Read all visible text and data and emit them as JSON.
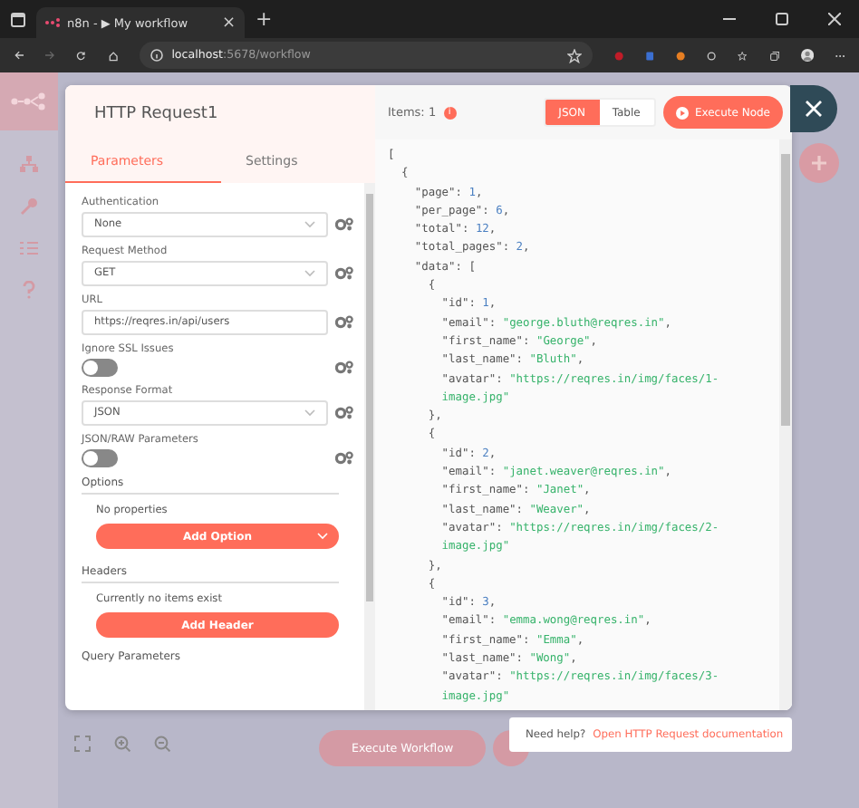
{
  "browser": {
    "tab_title": "n8n - ▶ My workflow",
    "tab_close": "×",
    "new_tab": "+",
    "address": {
      "host": "localhost",
      "rest": ":5678/workflow"
    }
  },
  "node": {
    "title": "HTTP Request1",
    "tabs": [
      {
        "label": "Parameters",
        "selected": true
      },
      {
        "label": "Settings",
        "selected": false
      }
    ],
    "parameters": [
      {
        "kind": "select",
        "label": "Authentication",
        "value": "None"
      },
      {
        "kind": "select",
        "label": "Request Method",
        "value": "GET"
      },
      {
        "kind": "input",
        "label": "URL",
        "value": "https://reqres.in/api/users"
      },
      {
        "kind": "toggle",
        "label": "Ignore SSL Issues",
        "on": false
      },
      {
        "kind": "select",
        "label": "Response Format",
        "value": "JSON"
      },
      {
        "kind": "toggle",
        "label": "JSON/RAW Parameters",
        "on": false
      }
    ],
    "sections": [
      {
        "title": "Options",
        "empty": "No properties",
        "button": "Add Option",
        "dropdown": true
      },
      {
        "title": "Headers",
        "empty": "Currently no items exist",
        "button": "Add Header",
        "dropdown": false
      }
    ],
    "next_section": "Query Parameters"
  },
  "output": {
    "items": "Items: 1",
    "info_badge": "i",
    "views": [
      {
        "label": "JSON",
        "selected": true
      },
      {
        "label": "Table",
        "selected": false
      }
    ],
    "execute_button": "Execute Node",
    "lines": [
      {
        "text": "["
      },
      {
        "text": "  {"
      },
      {
        "text": "    \"page\": ",
        "value": "1",
        "kind": "number",
        "end": ","
      },
      {
        "text": "    \"per_page\": ",
        "value": "6",
        "kind": "number",
        "end": ","
      },
      {
        "text": "    \"total\": ",
        "value": "12",
        "kind": "number",
        "end": ","
      },
      {
        "text": "    \"total_pages\": ",
        "value": "2",
        "kind": "number",
        "end": ","
      },
      {
        "text": "    \"data\": ["
      },
      {
        "text": "      {"
      },
      {
        "text": "        \"id\": ",
        "value": "1",
        "kind": "number",
        "end": ","
      },
      {
        "text": "        \"email\": ",
        "value": "\"george.bluth@reqres.in\"",
        "kind": "string",
        "end": ","
      },
      {
        "text": "        \"first_name\": ",
        "value": "\"George\"",
        "kind": "string",
        "end": ","
      },
      {
        "text": "        \"last_name\": ",
        "value": "\"Bluth\"",
        "kind": "string",
        "end": ","
      },
      {
        "text": "        \"avatar\": ",
        "value": "\"https://reqres.in/img/faces/1-",
        "kind": "string"
      },
      {
        "value": "image.jpg\"",
        "kind": "string"
      },
      {
        "text": "      },"
      },
      {
        "text": "      {"
      },
      {
        "text": "        \"id\": ",
        "value": "2",
        "kind": "number",
        "end": ","
      },
      {
        "text": "        \"email\": ",
        "value": "\"janet.weaver@reqres.in\"",
        "kind": "string",
        "end": ","
      },
      {
        "text": "        \"first_name\": ",
        "value": "\"Janet\"",
        "kind": "string",
        "end": ","
      },
      {
        "text": "        \"last_name\": ",
        "value": "\"Weaver\"",
        "kind": "string",
        "end": ","
      },
      {
        "text": "        \"avatar\": ",
        "value": "\"https://reqres.in/img/faces/2-",
        "kind": "string"
      },
      {
        "value": "image.jpg\"",
        "kind": "string"
      },
      {
        "text": "      },"
      },
      {
        "text": "      {"
      },
      {
        "text": "        \"id\": ",
        "value": "3",
        "kind": "number",
        "end": ","
      },
      {
        "text": "        \"email\": ",
        "value": "\"emma.wong@reqres.in\"",
        "kind": "string",
        "end": ","
      },
      {
        "text": "        \"first_name\": ",
        "value": "\"Emma\"",
        "kind": "string",
        "end": ","
      },
      {
        "text": "        \"last_name\": ",
        "value": "\"Wong\"",
        "kind": "string",
        "end": ","
      },
      {
        "text": "        \"avatar\": ",
        "value": "\"https://reqres.in/img/faces/3-",
        "kind": "string"
      },
      {
        "value": "image.jpg\"",
        "kind": "string"
      }
    ]
  },
  "canvas": {
    "execute_workflow": "Execute Workflow"
  },
  "help": {
    "text": "Need help?",
    "link": "Open HTTP Request documentation"
  }
}
